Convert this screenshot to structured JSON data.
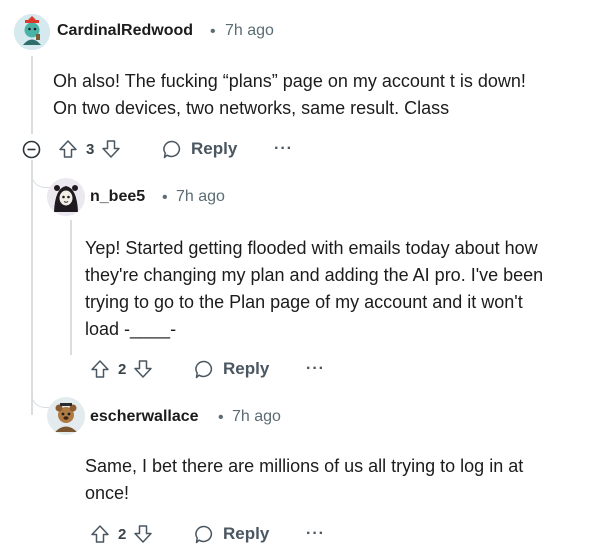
{
  "comments": [
    {
      "username": "CardinalRedwood",
      "separator": "•",
      "time": "7h ago",
      "lines": [
        "Oh also! The fucking “plans” page on my account t is down!",
        "On two devices, two networks, same result. Class"
      ],
      "votes": "3",
      "reply_label": "Reply",
      "more_label": "···"
    },
    {
      "username": "n_bee5",
      "separator": "•",
      "time": "7h ago",
      "lines": [
        "Yep! Started getting flooded with emails today about how",
        "they're changing my plan and adding the AI pro. I've been",
        "trying to go to the Plan page of my account and it won't",
        "load -____-"
      ],
      "votes": "2",
      "reply_label": "Reply",
      "more_label": "···"
    },
    {
      "username": "escherwallace",
      "separator": "•",
      "time": "7h ago",
      "lines": [
        "Same, I bet there are millions of us all trying to log in at",
        "once!"
      ],
      "votes": "2",
      "reply_label": "Reply",
      "more_label": "···"
    }
  ],
  "colors": {
    "text": "#1c1c1c",
    "meta": "#5c6c74",
    "thread_line": "#d9dde0",
    "icon": "#4a5660"
  },
  "icons": [
    "collapse-icon",
    "upvote-icon",
    "downvote-icon",
    "reply-icon",
    "more-icon"
  ]
}
